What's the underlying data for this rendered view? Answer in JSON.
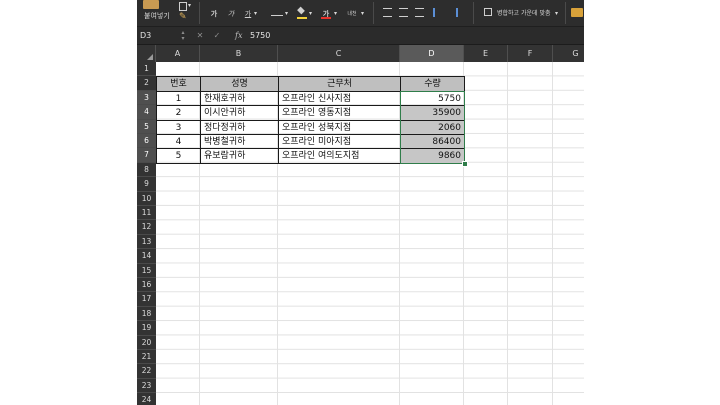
{
  "ribbon": {
    "paste_label": "붙여넣기",
    "font_a1": "가",
    "font_a2": "가",
    "font_a3": "가",
    "font_color_glyph": "가",
    "phonetic": "내천",
    "merge_label": "병합하고 가운데 맞춤",
    "font_color": "#e8322b",
    "fill_color": "#f4d23a"
  },
  "formula_bar": {
    "name_box": "D3",
    "fx": "fx",
    "value": "5750"
  },
  "columns": [
    "A",
    "B",
    "C",
    "D",
    "E",
    "F",
    "G"
  ],
  "selected_column": "D",
  "rows": [
    "1",
    "2",
    "3",
    "4",
    "5",
    "6",
    "7",
    "8",
    "9",
    "10",
    "11",
    "12",
    "13",
    "14",
    "15",
    "16",
    "17",
    "18",
    "19",
    "20",
    "21",
    "22",
    "23",
    "24"
  ],
  "selected_rows": [
    "3",
    "4",
    "5",
    "6",
    "7"
  ],
  "table": {
    "headers": [
      "번호",
      "성명",
      "근무처",
      "수량"
    ],
    "rows": [
      [
        "1",
        "한재호귀하",
        "오프라인 신사지점",
        "5750"
      ],
      [
        "2",
        "이시안귀하",
        "오프라인 영동지점",
        "35900"
      ],
      [
        "3",
        "정다정귀하",
        "오프라인 성북지점",
        "2060"
      ],
      [
        "4",
        "박병철귀하",
        "오프라인 미아지점",
        "86400"
      ],
      [
        "5",
        "유보람귀하",
        "오프라인 여의도지점",
        "9860"
      ]
    ]
  },
  "selection_color": "#2f7d4a"
}
